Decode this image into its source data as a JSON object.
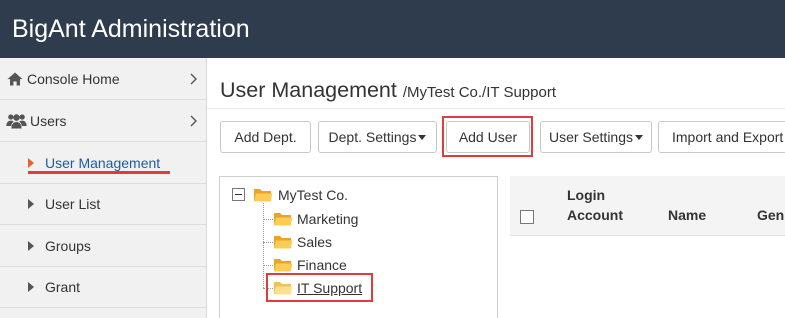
{
  "header": {
    "title": "BigAnt Administration"
  },
  "sidebar": {
    "items": [
      {
        "label": "Console Home",
        "icon": "home-icon"
      },
      {
        "label": "Users",
        "icon": "users-icon"
      }
    ],
    "subitems": [
      {
        "label": "User Management",
        "active": true,
        "underlined": true
      },
      {
        "label": "User List",
        "active": false
      },
      {
        "label": "Groups",
        "active": false
      },
      {
        "label": "Grant",
        "active": false
      }
    ]
  },
  "main": {
    "title": "User Management",
    "path": "/MyTest Co./IT Support",
    "toolbar": [
      {
        "label": "Add Dept.",
        "dropdown": false
      },
      {
        "label": "Dept. Settings",
        "dropdown": true
      },
      {
        "label": "Add User",
        "dropdown": false,
        "highlighted": true
      },
      {
        "label": "User Settings",
        "dropdown": true
      },
      {
        "label": "Import and Export",
        "dropdown": false
      }
    ],
    "tree": {
      "root": {
        "label": "MyTest Co.",
        "expanded": true
      },
      "children": [
        {
          "label": "Marketing"
        },
        {
          "label": "Sales"
        },
        {
          "label": "Finance"
        },
        {
          "label": "IT Support",
          "selected": true,
          "highlighted": true
        }
      ]
    },
    "table": {
      "select_all_checked": false,
      "columns": [
        "Login Account",
        "Name",
        "Gen"
      ]
    }
  },
  "colors": {
    "header_bg": "#2e3c4d",
    "sidebar_bg": "#f1f1f1",
    "active_link": "#1f5b9e",
    "active_marker": "#e2632f",
    "annotation_red": "#e23b3b",
    "folder": "#f7bd3a"
  }
}
